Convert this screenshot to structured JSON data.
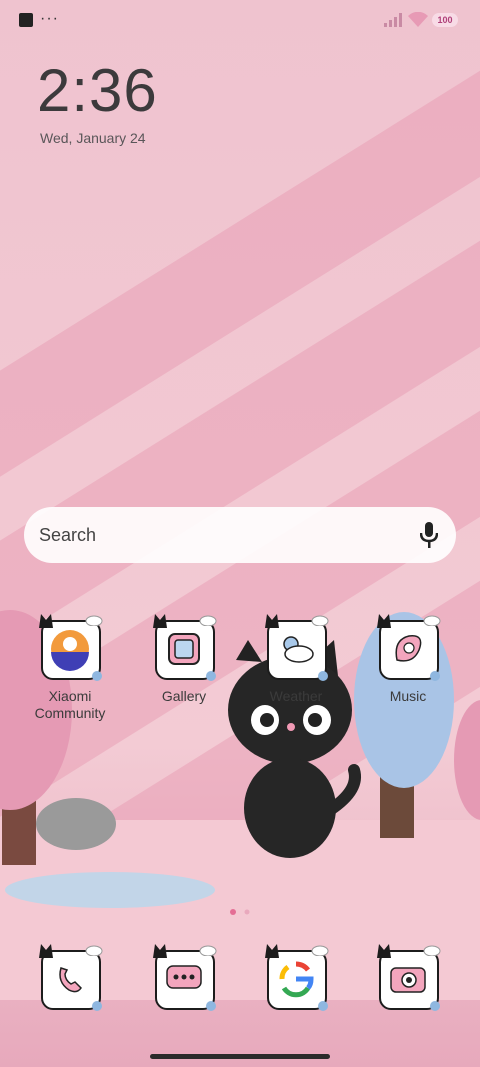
{
  "status_bar": {
    "battery_label": "100",
    "overflow_label": "···"
  },
  "clock": {
    "time": "2:36",
    "date": "Wed, January 24"
  },
  "search": {
    "placeholder": "Search"
  },
  "apps": [
    {
      "label": "Xiaomi Community",
      "icon": "xiaomi-community-icon"
    },
    {
      "label": "Gallery",
      "icon": "gallery-icon"
    },
    {
      "label": "Weather",
      "icon": "weather-icon"
    },
    {
      "label": "Music",
      "icon": "music-icon"
    }
  ],
  "dock": [
    {
      "icon": "phone-icon"
    },
    {
      "icon": "messages-icon"
    },
    {
      "icon": "google-icon"
    },
    {
      "icon": "camera-icon"
    }
  ],
  "page_indicator": {
    "pages": 2,
    "current": 1
  },
  "colors": {
    "accent": "#e98aa5",
    "wallpaper": "#efc3cf"
  }
}
